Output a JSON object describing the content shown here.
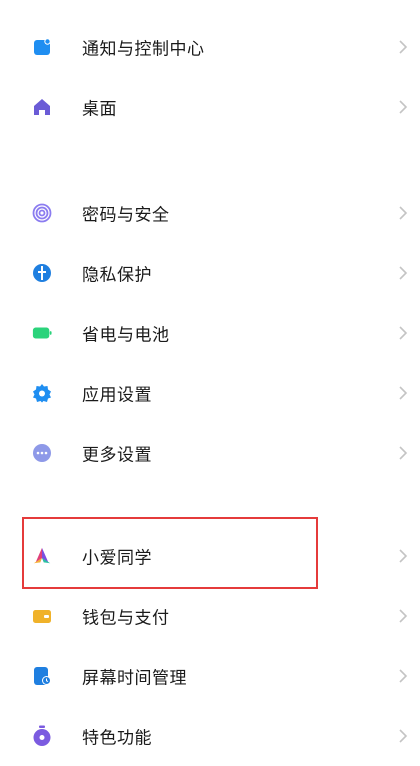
{
  "groups": [
    {
      "items": [
        {
          "label": "通知与控制中心",
          "icon": "notification-icon"
        },
        {
          "label": "桌面",
          "icon": "home-icon"
        }
      ]
    },
    {
      "items": [
        {
          "label": "密码与安全",
          "icon": "fingerprint-icon"
        },
        {
          "label": "隐私保护",
          "icon": "privacy-shield-icon"
        },
        {
          "label": "省电与电池",
          "icon": "battery-icon"
        },
        {
          "label": "应用设置",
          "icon": "gear-icon"
        },
        {
          "label": "更多设置",
          "icon": "more-icon"
        }
      ]
    },
    {
      "items": [
        {
          "label": "小爱同学",
          "icon": "xiaoai-icon",
          "highlighted": true
        },
        {
          "label": "钱包与支付",
          "icon": "wallet-icon"
        },
        {
          "label": "屏幕时间管理",
          "icon": "screen-time-icon"
        },
        {
          "label": "特色功能",
          "icon": "features-icon"
        }
      ]
    }
  ],
  "colors": {
    "notification": "#1f8ef1",
    "home": "#6a5bd6",
    "fingerprint": "#8b7cf0",
    "privacy": "#1f7fe0",
    "battery": "#2bd37b",
    "gear": "#1f8ef1",
    "more": "#8e99e8",
    "wallet": "#f0b22a",
    "screen_time": "#1f7fe0",
    "features": "#7b5be0",
    "highlight_border": "#e53b3b"
  }
}
